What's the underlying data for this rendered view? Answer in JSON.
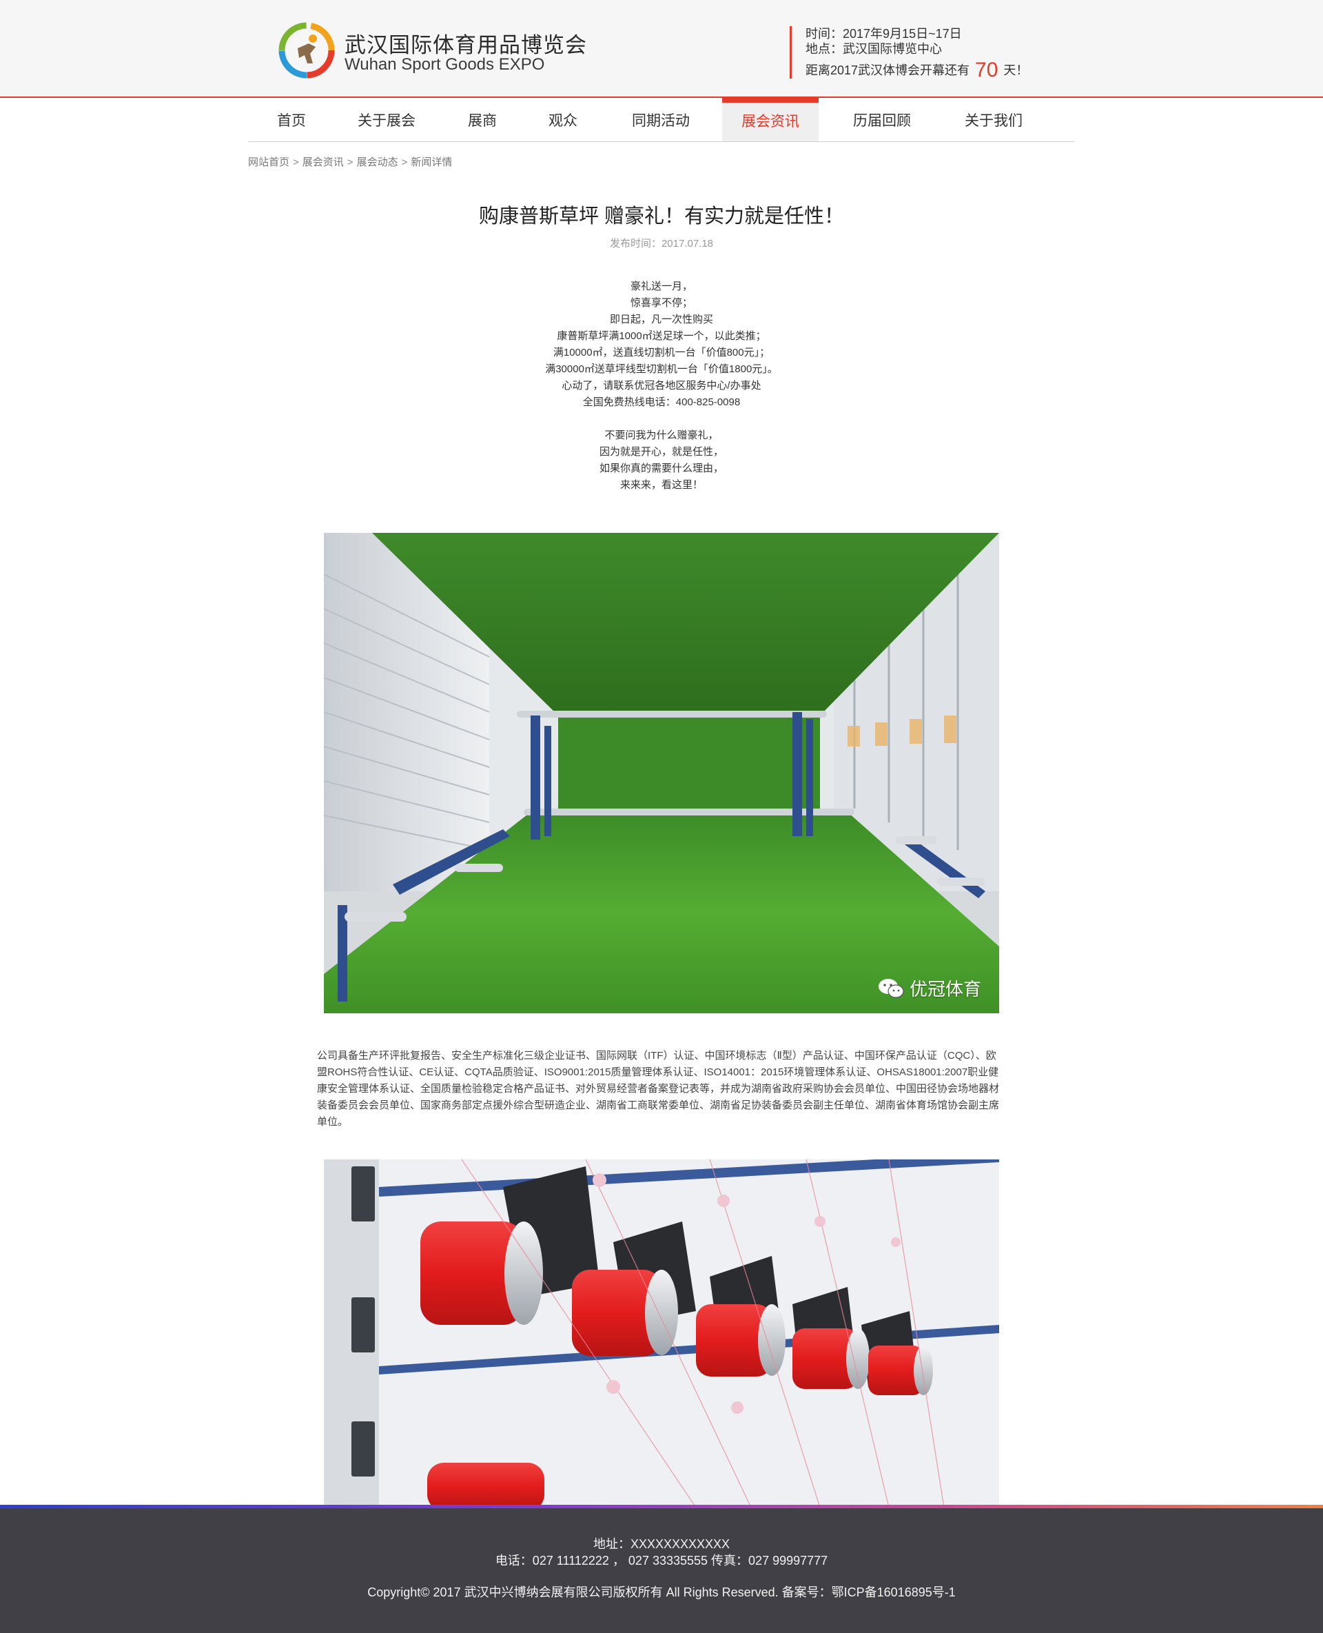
{
  "header": {
    "logo_cn": "武汉国际体育用品博览会",
    "logo_en": "Wuhan Sport Goods EXPO",
    "time": "时间：2017年9月15日~17日",
    "place": "地点：武汉国际博览中心",
    "countdown_prefix": "距离2017武汉体博会开幕还有",
    "countdown_value": "70",
    "countdown_suffix": "天！"
  },
  "nav": {
    "items": [
      {
        "label": "首页"
      },
      {
        "label": "关于展会"
      },
      {
        "label": "展商"
      },
      {
        "label": "观众"
      },
      {
        "label": "同期活动"
      },
      {
        "label": "展会资讯"
      },
      {
        "label": "历届回顾"
      },
      {
        "label": "关于我们"
      }
    ],
    "active_index": 5
  },
  "breadcrumb": {
    "items": [
      "网站首页",
      "展会资讯",
      "展会动态",
      "新闻详情"
    ],
    "separator": ">"
  },
  "article": {
    "title": "购康普斯草坪 赠豪礼！有实力就是任性！",
    "date": "发布时间：2017.07.18",
    "intro_lines": [
      "豪礼送一月，",
      "惊喜享不停；",
      "即日起，凡一次性购买",
      "康普斯草坪满1000㎡送足球一个，以此类推；",
      "满10000㎡，送直线切割机一台「价值800元」；",
      "满30000㎡送草坪线型切割机一台「价值1800元」。",
      "心动了，请联系优冠各地区服务中心/办事处",
      "全国免费热线电话：400-825-0098"
    ],
    "intro_lines_2": [
      "不要问我为什么赠豪礼，",
      "因为就是开心，就是任性，",
      "如果你真的需要什么理由，",
      "来来来，看这里！"
    ],
    "watermark": "优冠体育",
    "company_paragraph": "公司具备生产环评批复报告、安全生产标准化三级企业证书、国际网联（ITF）认证、中国环境标志（Ⅱ型）产品认证、中国环保产品认证（CQC）、欧盟ROHS符合性认证、CE认证、CQTA品质验证、ISO9001:2015质量管理体系认证、ISO14001：2015环境管理体系认证、OHSAS18001:2007职业健康安全管理体系认证、全国质量检验稳定合格产品证书、对外贸易经营者备案登记表等，并成为湖南省政府采购协会会员单位、中国田径协会场地器材装备委员会会员单位、国家商务部定点援外综合型研造企业、湖南省工商联常委单位、湖南省足协装备委员会副主任单位、湖南省体育场馆协会副主席单位。"
  },
  "footer": {
    "address": "地址：XXXXXXXXXXXX",
    "phone": "电话：027 11112222 ，  027 33335555 传真：027 99997777",
    "copyright": "Copyright© 2017 武汉中兴博纳会展有限公司版权所有 All Rights Reserved.  备案号：鄂ICP备16016895号-1"
  },
  "colors": {
    "accent": "#e63a2a",
    "footer_bg": "#404046",
    "turf_green": "#4a9a2e",
    "spool_red": "#e0201e"
  }
}
